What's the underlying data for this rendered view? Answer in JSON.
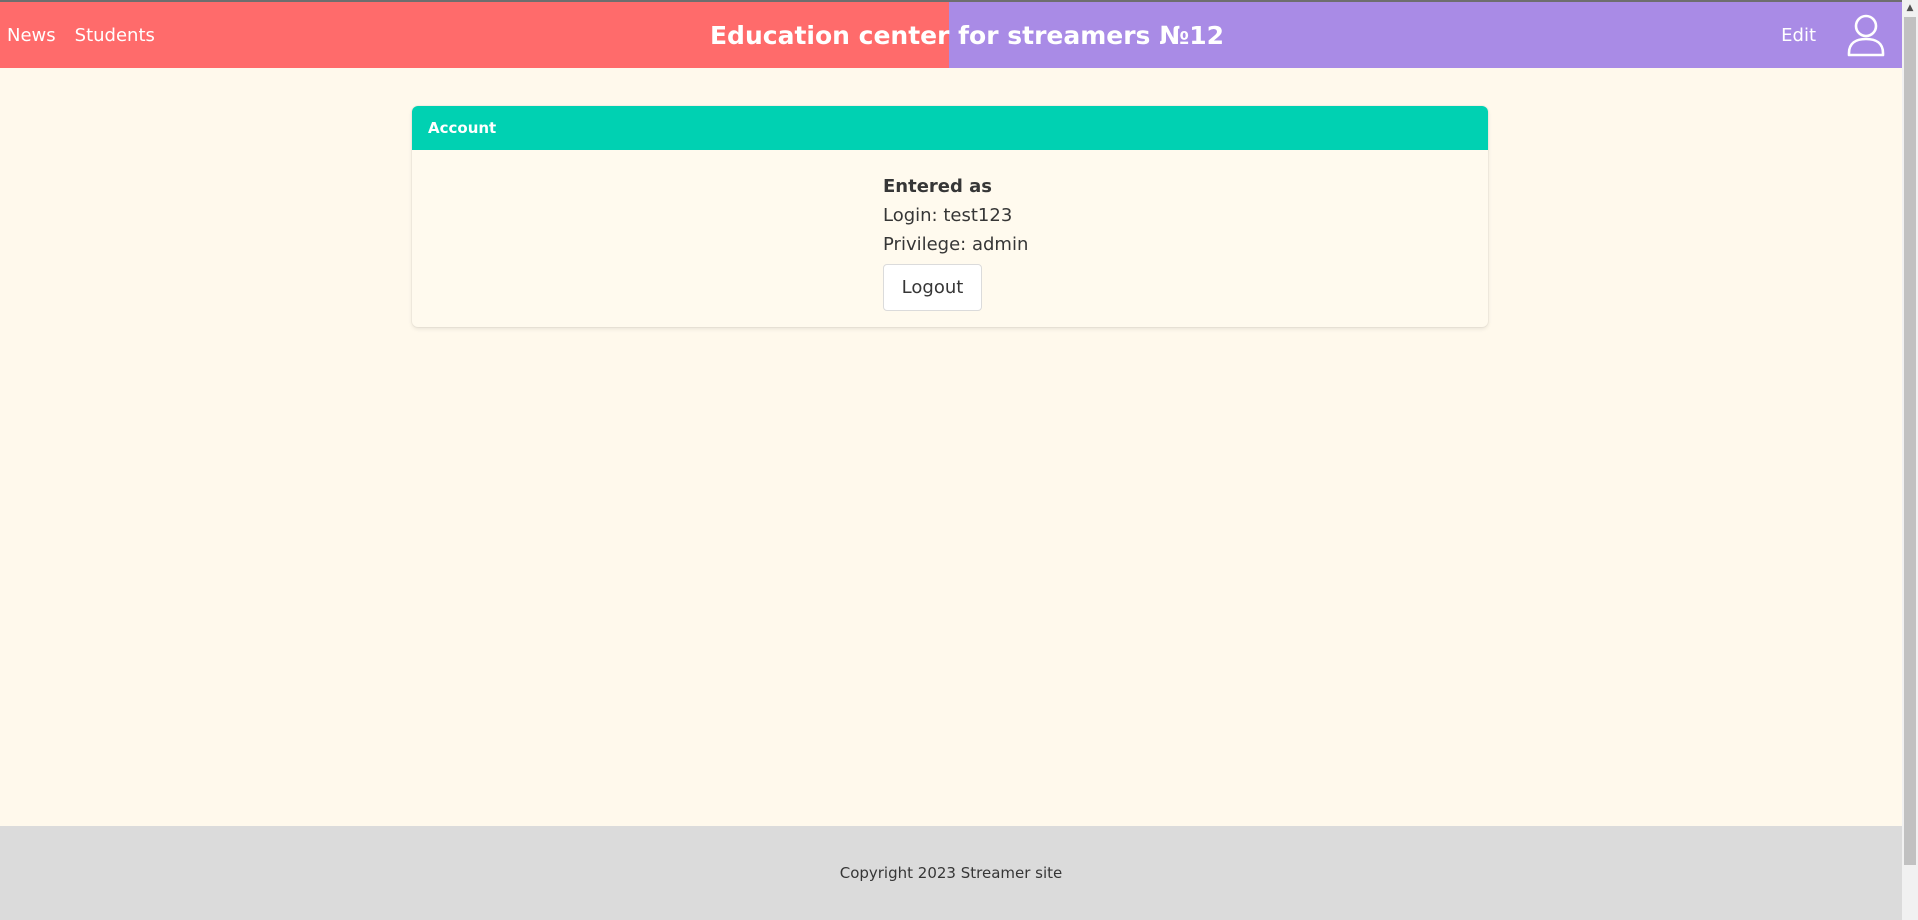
{
  "navbar": {
    "links": [
      "News",
      "Students"
    ],
    "brand": "Education center for streamers №12",
    "edit_label": "Edit",
    "user_icon": "user-icon",
    "colors": {
      "left": "#ff6b6b",
      "right": "#a98be6"
    }
  },
  "account_card": {
    "title": "Account",
    "header_color": "#00d1b2",
    "entered_as": "Entered as",
    "login": "Login: test123",
    "privilege": "Privilege: admin",
    "logout_label": "Logout"
  },
  "footer": {
    "copyright": "Copyright 2023 Streamer site"
  },
  "scrollbar": {
    "up_icon": "arrow-up-icon"
  }
}
